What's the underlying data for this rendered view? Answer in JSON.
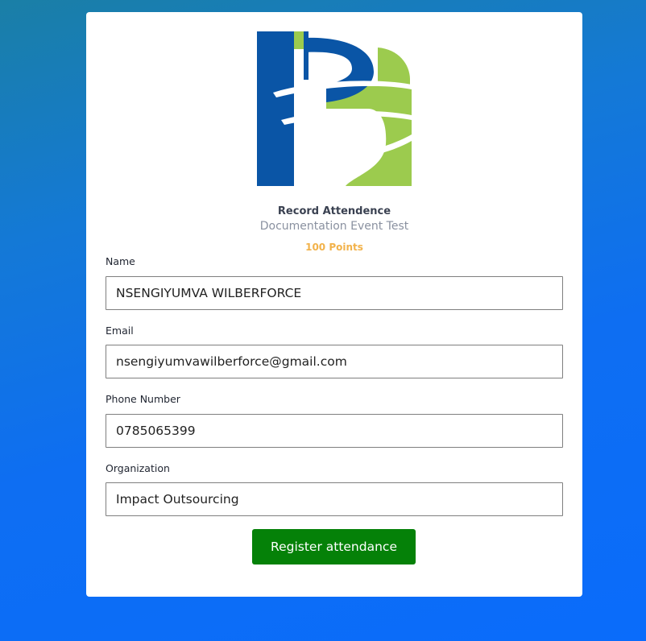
{
  "colors": {
    "background_top": "#1a7fa6",
    "background_bottom": "#0a6cfb",
    "card": "#ffffff",
    "logo_blue": "#0a55a6",
    "logo_green": "#9ccb4e",
    "points_color": "#f2b24a",
    "button_color": "#058108"
  },
  "header": {
    "logo_icon": "logo-icon",
    "title": "Record Attendence",
    "event": "Documentation Event Test",
    "points": "100 Points"
  },
  "form": {
    "name_label": "Name",
    "name_value": "NSENGIYUMVA WILBERFORCE",
    "email_label": "Email",
    "email_value": "nsengiyumvawilberforce@gmail.com",
    "phone_label": "Phone Number",
    "phone_value": "0785065399",
    "org_label": "Organization",
    "org_value": "Impact Outsourcing",
    "submit_label": "Register attendance"
  }
}
